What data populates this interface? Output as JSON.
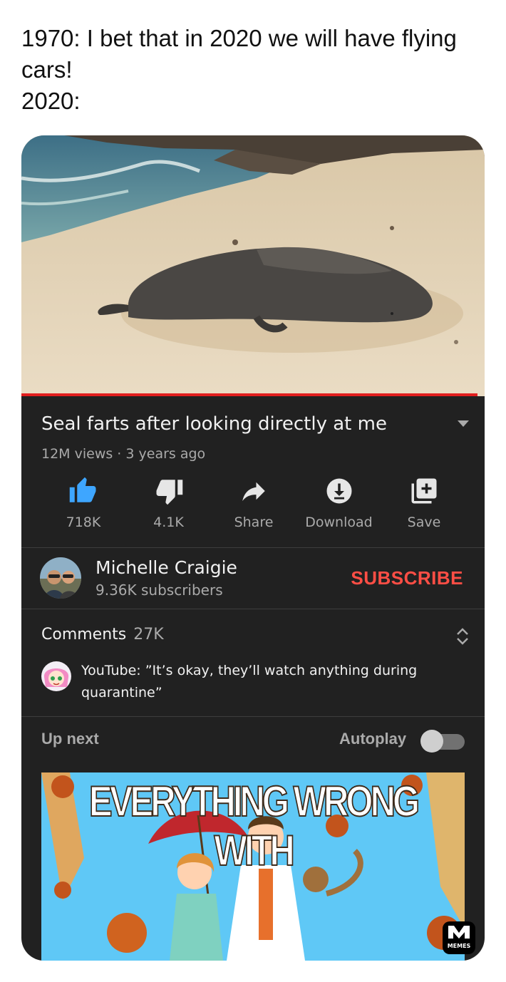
{
  "caption": {
    "line1": "1970: I bet that in 2020 we will have flying cars!",
    "line2": "2020:"
  },
  "video": {
    "title": "Seal farts after looking directly at me",
    "views": "12M views",
    "age": "3 years ago",
    "progress": 0.985
  },
  "actions": [
    {
      "icon": "thumbs-up-icon",
      "label": "718K"
    },
    {
      "icon": "thumbs-down-icon",
      "label": "4.1K"
    },
    {
      "icon": "share-icon",
      "label": "Share"
    },
    {
      "icon": "download-icon",
      "label": "Download"
    },
    {
      "icon": "save-to-playlist-icon",
      "label": "Save"
    }
  ],
  "channel": {
    "name": "Michelle Craigie",
    "subscribers": "9.36K subscribers",
    "subscribe_label": "SUBSCRIBE"
  },
  "comments": {
    "header": "Comments",
    "count": "27K",
    "top_comment": "YouTube: ”It’s okay, they’ll watch anything during quarantine”"
  },
  "upnext": {
    "label": "Up next",
    "autoplay_label": "Autoplay",
    "autoplay_on": false,
    "thumbnail_text": "EVERYTHING WRONG WITH"
  },
  "watermark": {
    "label": "MEMES"
  },
  "colors": {
    "panel": "#212121",
    "accent_red": "#ff4e45",
    "progress_red": "#e11e1e",
    "like_blue": "#3ea6ff"
  }
}
